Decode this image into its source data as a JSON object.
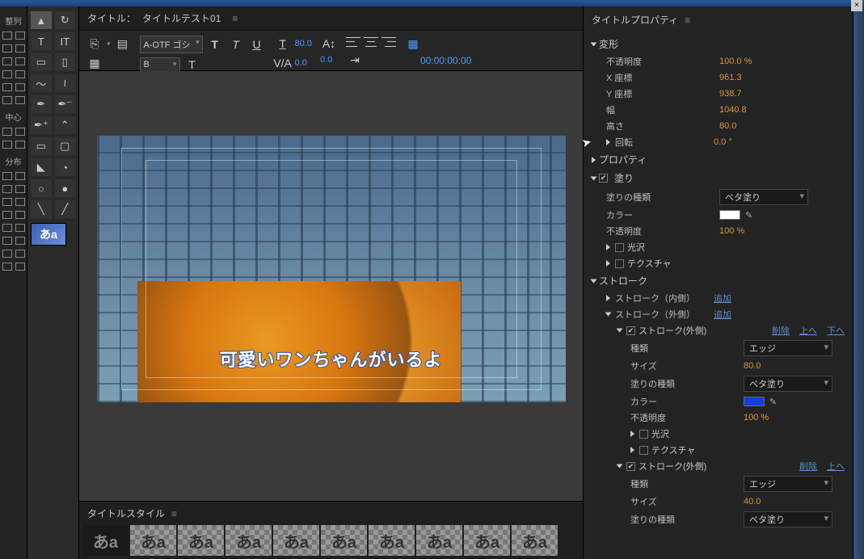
{
  "window": {
    "title_prefix": "タイトル：",
    "title_name": "タイトルテスト01"
  },
  "rail": {
    "align": "整列",
    "center": "中心",
    "distribute": "分布"
  },
  "toolbar": {
    "font": "A-OTF ゴシ",
    "weight": "B",
    "size": "80.0",
    "leading": "0.0",
    "kerning": "0.0",
    "timecode": "00:00:00:00"
  },
  "thumb_text": "あa",
  "canvas": {
    "caption": "可愛いワンちゃんがいるよ"
  },
  "styles": {
    "title": "タイトルスタイル",
    "sample": "あa"
  },
  "props": {
    "title": "タイトルプロパティ",
    "transform": {
      "label": "変形",
      "opacity_l": "不透明度",
      "opacity_v": "100.0 %",
      "x_l": "X 座標",
      "x_v": "961.3",
      "y_l": "Y 座標",
      "y_v": "938.7",
      "w_l": "幅",
      "w_v": "1040.8",
      "h_l": "高さ",
      "h_v": "80.0",
      "rot_l": "回転",
      "rot_v": "0.0 °"
    },
    "properties_l": "プロパティ",
    "fill": {
      "label": "塗り",
      "type_l": "塗りの種類",
      "type_v": "ベタ塗り",
      "color_l": "カラー",
      "color_v": "#ffffff",
      "opacity_l": "不透明度",
      "opacity_v": "100 %",
      "gloss_l": "光沢",
      "texture_l": "テクスチャ"
    },
    "stroke": {
      "label": "ストローク",
      "inner_l": "ストローク（内側）",
      "outer_l": "ストローク（外側）",
      "add": "追加",
      "delete": "削除",
      "up": "上へ",
      "down": "下へ",
      "item_l": "ストローク(外側)",
      "kind_l": "種類",
      "kind_v": "エッジ",
      "size_l": "サイズ",
      "size1": "80.0",
      "size2": "40.0",
      "filltype_l": "塗りの種類",
      "filltype_v": "ベタ塗り",
      "color_l": "カラー",
      "color1": "#1040e0",
      "opacity_l": "不透明度",
      "opacity_v": "100 %",
      "gloss_l": "光沢",
      "texture_l": "テクスチャ"
    }
  }
}
